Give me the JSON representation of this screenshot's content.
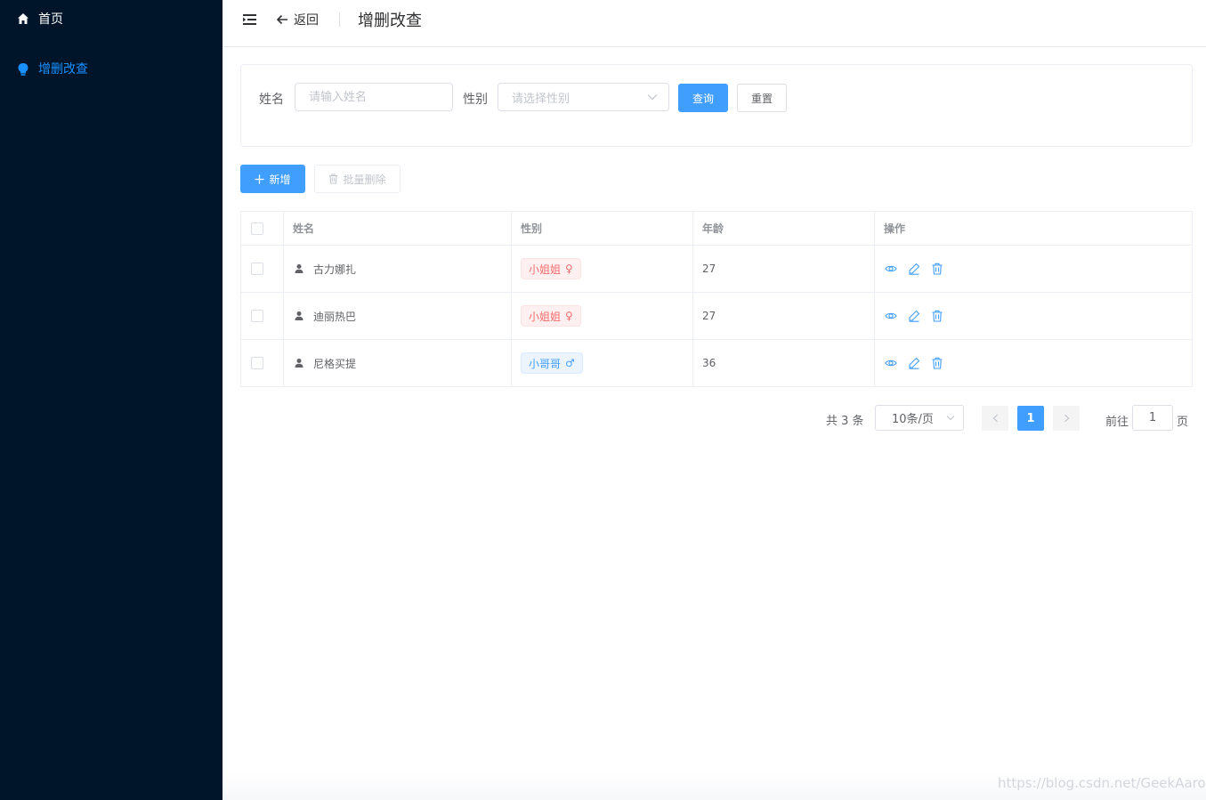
{
  "sidebar": {
    "items": [
      {
        "label": "首页",
        "icon": "home-icon",
        "active": false
      },
      {
        "label": "增删改查",
        "icon": "bulb-icon",
        "active": true
      }
    ]
  },
  "header": {
    "back_label": "返回",
    "title": "增删改查"
  },
  "search": {
    "name_label": "姓名",
    "name_placeholder": "请输入姓名",
    "gender_label": "性别",
    "gender_placeholder": "请选择性别",
    "query_label": "查询",
    "reset_label": "重置"
  },
  "toolbar": {
    "add_label": "新增",
    "batch_delete_label": "批量删除"
  },
  "table": {
    "columns": [
      "姓名",
      "性别",
      "年龄",
      "操作"
    ],
    "rows": [
      {
        "name": "古力娜扎",
        "gender": "小姐姐",
        "gender_symbol": "♀",
        "gender_type": "girl",
        "age": "27"
      },
      {
        "name": "迪丽热巴",
        "gender": "小姐姐",
        "gender_symbol": "♀",
        "gender_type": "girl",
        "age": "27"
      },
      {
        "name": "尼格买提",
        "gender": "小哥哥",
        "gender_symbol": "♂",
        "gender_type": "boy",
        "age": "36"
      }
    ]
  },
  "pagination": {
    "total_text": "共 3 条",
    "page_size": "10条/页",
    "current_page": "1",
    "goto_label": "前往",
    "jump_value": "1",
    "page_suffix": "页"
  },
  "watermark": "https://blog.csdn.net/GeekAaron",
  "colors": {
    "sidebar_bg": "#001529",
    "active_menu": "#1890ff",
    "primary": "#409eff",
    "danger": "#f56c6c"
  }
}
